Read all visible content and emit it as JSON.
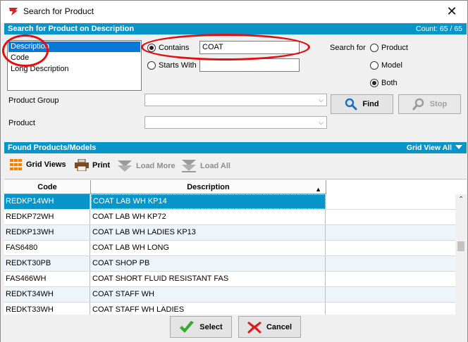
{
  "window": {
    "title": "Search for Product",
    "close_glyph": "✕"
  },
  "search_section": {
    "title": "Search for Product on Description",
    "count": "Count: 65 / 65"
  },
  "field_list": {
    "items": [
      "Description",
      "Code",
      "Long Description"
    ],
    "selected": "Description"
  },
  "match_mode": {
    "contains_label": "Contains",
    "starts_with_label": "Starts With",
    "selected": "Contains",
    "contains_value": "COAT",
    "starts_with_value": ""
  },
  "search_for": {
    "label": "Search for",
    "options": [
      "Product",
      "Model",
      "Both"
    ],
    "selected": "Both"
  },
  "filters": {
    "product_group_label": "Product Group",
    "product_group_value": "",
    "product_label": "Product",
    "product_value": ""
  },
  "buttons": {
    "find": "Find",
    "stop": "Stop",
    "select": "Select",
    "cancel": "Cancel"
  },
  "found_section": {
    "title": "Found Products/Models",
    "grid_view_label": "Grid View All"
  },
  "toolbar": {
    "grid_views": "Grid Views",
    "print": "Print",
    "load_more": "Load More",
    "load_all": "Load All"
  },
  "grid": {
    "columns": [
      "Code",
      "Description"
    ],
    "sort_indicator": "▲",
    "rows": [
      {
        "code": "REDKP14WH",
        "description": "COAT LAB WH KP14"
      },
      {
        "code": "REDKP72WH",
        "description": "COAT LAB WH KP72"
      },
      {
        "code": "REDKP13WH",
        "description": "COAT LAB WH LADIES KP13"
      },
      {
        "code": "FAS6480",
        "description": "COAT LAB WH LONG"
      },
      {
        "code": "REDKT30PB",
        "description": "COAT SHOP PB"
      },
      {
        "code": "FAS466WH",
        "description": "COAT SHORT FLUID RESISTANT FAS"
      },
      {
        "code": "REDKT34WH",
        "description": "COAT STAFF WH"
      },
      {
        "code": "REDKT33WH",
        "description": "COAT STAFF WH LADIES"
      }
    ],
    "selected_row": 0
  },
  "colors": {
    "section_bar": "#0a95c9",
    "selection": "#0a78d7",
    "annotation": "#e01010",
    "find_icon": "#1a6fc4",
    "select_icon": "#3aaa2a",
    "cancel_icon": "#d81e1e"
  },
  "icons": {
    "app": "app-logo-icon",
    "find": "magnifier-icon",
    "stop": "magnifier-disabled-icon",
    "grid_views": "grid-icon",
    "print": "printer-icon",
    "load_more": "load-more-icon",
    "load_all": "load-all-icon",
    "select": "checkmark-icon",
    "cancel": "x-icon"
  }
}
